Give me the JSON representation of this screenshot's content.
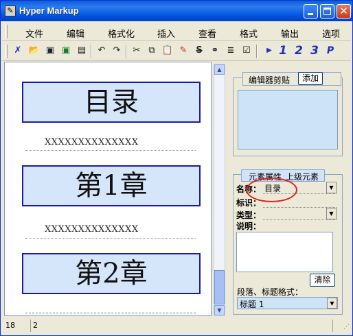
{
  "window": {
    "title": "Hyper Markup"
  },
  "menu": [
    "文件",
    "编辑",
    "格式化",
    "插入",
    "查看",
    "格式",
    "输出",
    "选项"
  ],
  "toolbar": {
    "icons": [
      "select-icon",
      "open-folder-icon",
      "save-icon",
      "save-all-icon",
      "properties-icon",
      "undo-icon",
      "redo-icon",
      "cut-icon",
      "copy-icon",
      "paste-icon",
      "erase-icon",
      "strikethrough-icon",
      "find-icon",
      "list-icon",
      "edit-icon",
      "play-icon"
    ],
    "headings": [
      "1",
      "2",
      "3",
      "P"
    ]
  },
  "editor": {
    "blocks": [
      {
        "type": "heading",
        "text": "目录"
      },
      {
        "type": "paragraph",
        "text": "XXXXXXXXXXXXXX"
      },
      {
        "type": "heading",
        "text": "第1章"
      },
      {
        "type": "paragraph",
        "text": "XXXXXXXXXXXXXX"
      },
      {
        "type": "heading",
        "text": "第2章"
      }
    ]
  },
  "clipboard_panel": {
    "title": "编辑器剪贴",
    "add_button": "添加"
  },
  "props_panel": {
    "tabs": [
      "元素属性",
      "上级元素"
    ],
    "name_label": "名称：",
    "name_value": "目录",
    "id_label": "标识：",
    "type_label": "类型：",
    "desc_label": "说明：",
    "clear_button": "清除",
    "format_label": "段落、标题格式：",
    "format_value": "标题 1"
  },
  "status": {
    "line": "18",
    "col": "2"
  }
}
